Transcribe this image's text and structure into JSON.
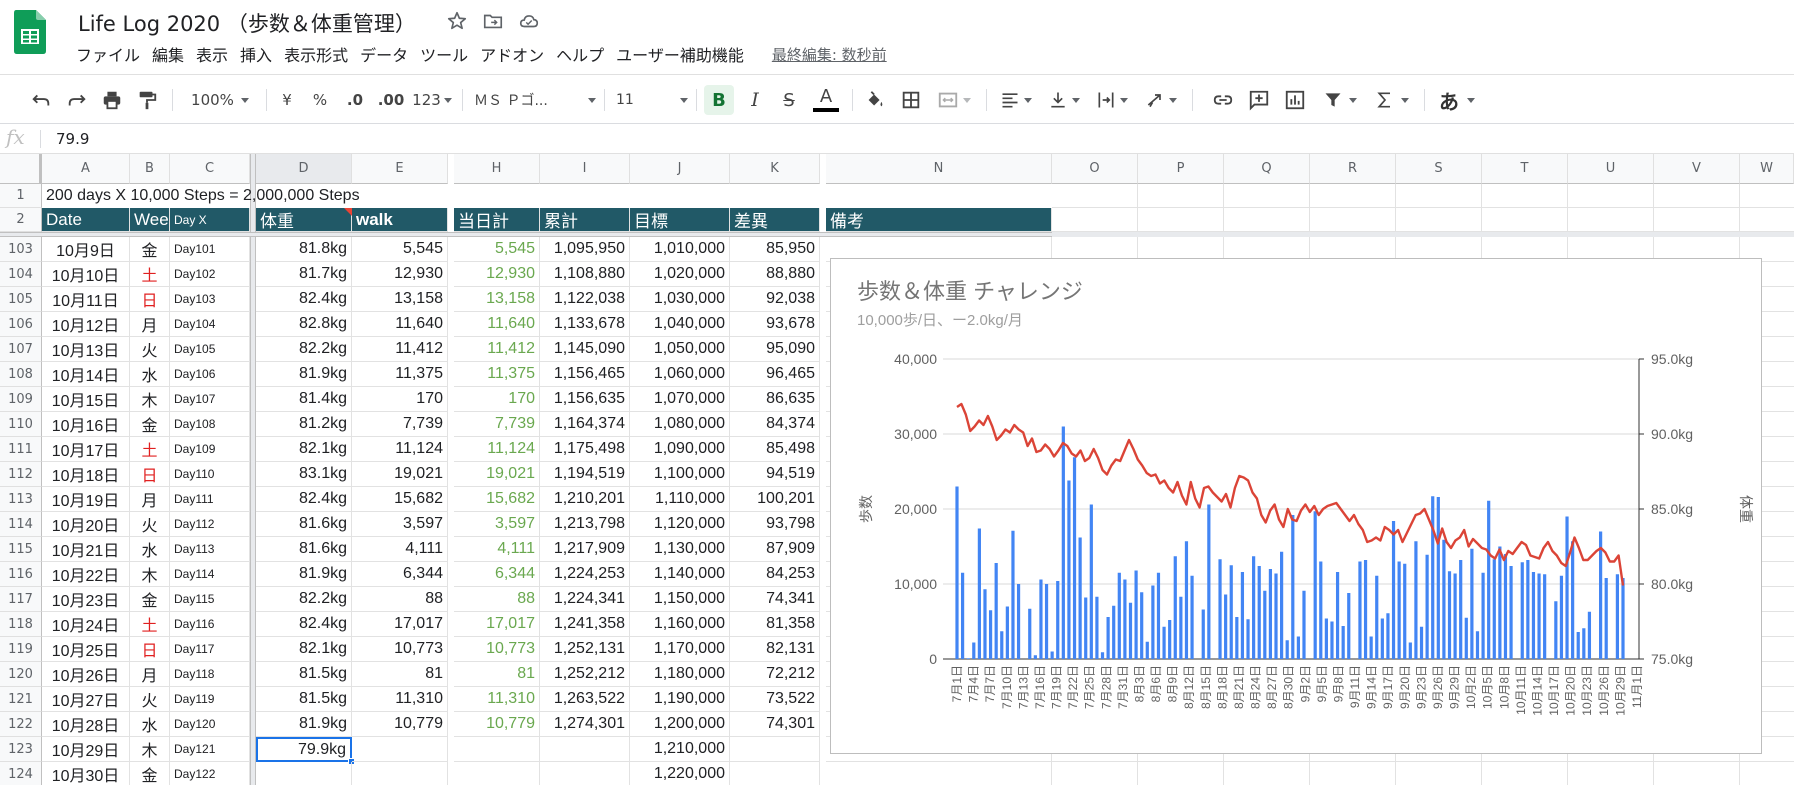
{
  "app": {
    "title": "Life Log 2020 （歩数＆体重管理）",
    "menu": [
      "ファイル",
      "編集",
      "表示",
      "挿入",
      "表示形式",
      "データ",
      "ツール",
      "アドオン",
      "ヘルプ",
      "ユーザー補助機能"
    ],
    "last_edit": "最終編集: 数秒前"
  },
  "toolbar": {
    "zoom": "100%",
    "currency": "¥",
    "percent": "%",
    "dec_less": ".0",
    "dec_more": ".00",
    "format_more": "123",
    "font": "ＭＳ Ｐゴ...",
    "font_size": "11",
    "bold": "B",
    "italic": "I",
    "strike": "S",
    "text_color": "A",
    "input_tool": "あ"
  },
  "formula_bar": {
    "fx": "fx",
    "value": "79.9"
  },
  "columns": {
    "A": "A",
    "B": "B",
    "C": "C",
    "D": "D",
    "E": "E",
    "H": "H",
    "I": "I",
    "J": "J",
    "K": "K",
    "N": "N",
    "O": "O",
    "P": "P",
    "Q": "Q",
    "R": "R",
    "S": "S",
    "T": "T",
    "U": "U",
    "V": "V",
    "W": "W"
  },
  "row1": {
    "num": "1",
    "text": "200 days X 10,000 Steps = 2,000,000 Steps"
  },
  "row2": {
    "num": "2",
    "date": "Date",
    "week": "Week",
    "dayx": "Day X",
    "weight": "体重",
    "walk": "walk",
    "today": "当日計",
    "cum": "累計",
    "target": "目標",
    "diff": "差異",
    "note": "備考"
  },
  "rows": [
    {
      "num": "103",
      "date": "10月9日",
      "week": "金",
      "wc": "",
      "day": "Day101",
      "wt": "81.8kg",
      "walk": "5,545",
      "today": "5,545",
      "cum": "1,095,950",
      "target": "1,010,000",
      "diff": "85,950"
    },
    {
      "num": "104",
      "date": "10月10日",
      "week": "土",
      "wc": "red",
      "day": "Day102",
      "wt": "81.7kg",
      "walk": "12,930",
      "today": "12,930",
      "cum": "1,108,880",
      "target": "1,020,000",
      "diff": "88,880"
    },
    {
      "num": "105",
      "date": "10月11日",
      "week": "日",
      "wc": "red",
      "day": "Day103",
      "wt": "82.4kg",
      "walk": "13,158",
      "today": "13,158",
      "cum": "1,122,038",
      "target": "1,030,000",
      "diff": "92,038"
    },
    {
      "num": "106",
      "date": "10月12日",
      "week": "月",
      "wc": "",
      "day": "Day104",
      "wt": "82.8kg",
      "walk": "11,640",
      "today": "11,640",
      "cum": "1,133,678",
      "target": "1,040,000",
      "diff": "93,678"
    },
    {
      "num": "107",
      "date": "10月13日",
      "week": "火",
      "wc": "",
      "day": "Day105",
      "wt": "82.2kg",
      "walk": "11,412",
      "today": "11,412",
      "cum": "1,145,090",
      "target": "1,050,000",
      "diff": "95,090"
    },
    {
      "num": "108",
      "date": "10月14日",
      "week": "水",
      "wc": "",
      "day": "Day106",
      "wt": "81.9kg",
      "walk": "11,375",
      "today": "11,375",
      "cum": "1,156,465",
      "target": "1,060,000",
      "diff": "96,465"
    },
    {
      "num": "109",
      "date": "10月15日",
      "week": "木",
      "wc": "",
      "day": "Day107",
      "wt": "81.4kg",
      "walk": "170",
      "today": "170",
      "cum": "1,156,635",
      "target": "1,070,000",
      "diff": "86,635"
    },
    {
      "num": "110",
      "date": "10月16日",
      "week": "金",
      "wc": "",
      "day": "Day108",
      "wt": "81.2kg",
      "walk": "7,739",
      "today": "7,739",
      "cum": "1,164,374",
      "target": "1,080,000",
      "diff": "84,374"
    },
    {
      "num": "111",
      "date": "10月17日",
      "week": "土",
      "wc": "red",
      "day": "Day109",
      "wt": "82.1kg",
      "walk": "11,124",
      "today": "11,124",
      "cum": "1,175,498",
      "target": "1,090,000",
      "diff": "85,498"
    },
    {
      "num": "112",
      "date": "10月18日",
      "week": "日",
      "wc": "red",
      "day": "Day110",
      "wt": "83.1kg",
      "walk": "19,021",
      "today": "19,021",
      "cum": "1,194,519",
      "target": "1,100,000",
      "diff": "94,519"
    },
    {
      "num": "113",
      "date": "10月19日",
      "week": "月",
      "wc": "",
      "day": "Day111",
      "wt": "82.4kg",
      "walk": "15,682",
      "today": "15,682",
      "cum": "1,210,201",
      "target": "1,110,000",
      "diff": "100,201"
    },
    {
      "num": "114",
      "date": "10月20日",
      "week": "火",
      "wc": "",
      "day": "Day112",
      "wt": "81.6kg",
      "walk": "3,597",
      "today": "3,597",
      "cum": "1,213,798",
      "target": "1,120,000",
      "diff": "93,798"
    },
    {
      "num": "115",
      "date": "10月21日",
      "week": "水",
      "wc": "",
      "day": "Day113",
      "wt": "81.6kg",
      "walk": "4,111",
      "today": "4,111",
      "cum": "1,217,909",
      "target": "1,130,000",
      "diff": "87,909"
    },
    {
      "num": "116",
      "date": "10月22日",
      "week": "木",
      "wc": "",
      "day": "Day114",
      "wt": "81.9kg",
      "walk": "6,344",
      "today": "6,344",
      "cum": "1,224,253",
      "target": "1,140,000",
      "diff": "84,253"
    },
    {
      "num": "117",
      "date": "10月23日",
      "week": "金",
      "wc": "",
      "day": "Day115",
      "wt": "82.2kg",
      "walk": "88",
      "today": "88",
      "cum": "1,224,341",
      "target": "1,150,000",
      "diff": "74,341"
    },
    {
      "num": "118",
      "date": "10月24日",
      "week": "土",
      "wc": "red",
      "day": "Day116",
      "wt": "82.4kg",
      "walk": "17,017",
      "today": "17,017",
      "cum": "1,241,358",
      "target": "1,160,000",
      "diff": "81,358"
    },
    {
      "num": "119",
      "date": "10月25日",
      "week": "日",
      "wc": "red",
      "day": "Day117",
      "wt": "82.1kg",
      "walk": "10,773",
      "today": "10,773",
      "cum": "1,252,131",
      "target": "1,170,000",
      "diff": "82,131"
    },
    {
      "num": "120",
      "date": "10月26日",
      "week": "月",
      "wc": "",
      "day": "Day118",
      "wt": "81.5kg",
      "walk": "81",
      "today": "81",
      "cum": "1,252,212",
      "target": "1,180,000",
      "diff": "72,212"
    },
    {
      "num": "121",
      "date": "10月27日",
      "week": "火",
      "wc": "",
      "day": "Day119",
      "wt": "81.5kg",
      "walk": "11,310",
      "today": "11,310",
      "cum": "1,263,522",
      "target": "1,190,000",
      "diff": "73,522"
    },
    {
      "num": "122",
      "date": "10月28日",
      "week": "水",
      "wc": "",
      "day": "Day120",
      "wt": "81.9kg",
      "walk": "10,779",
      "today": "10,779",
      "cum": "1,274,301",
      "target": "1,200,000",
      "diff": "74,301"
    },
    {
      "num": "123",
      "date": "10月29日",
      "week": "木",
      "wc": "",
      "day": "Day121",
      "wt": "79.9kg",
      "walk": "",
      "today": "",
      "cum": "",
      "target": "1,210,000",
      "diff": ""
    },
    {
      "num": "124",
      "date": "10月30日",
      "week": "金",
      "wc": "",
      "day": "Day122",
      "wt": "",
      "walk": "",
      "today": "",
      "cum": "",
      "target": "1,220,000",
      "diff": ""
    }
  ],
  "colors": {
    "header_bg": "#215967",
    "bar": "#4285f4",
    "line": "#db4437",
    "today_text": "#6aa84f",
    "weekend": "#e02020"
  },
  "chart_data": {
    "type": "bar",
    "title": "歩数＆体重 チャレンジ",
    "subtitle": "10,000歩/日、ー2.0kg/月",
    "ylabel_left": "歩数",
    "ylabel_right": "体重",
    "left_ticks": [
      "0",
      "10,000",
      "20,000",
      "30,000",
      "40,000"
    ],
    "right_ticks": [
      "75.0kg",
      "80.0kg",
      "85.0kg",
      "90.0kg",
      "95.0kg"
    ],
    "ylim_left": [
      0,
      40000
    ],
    "ylim_right": [
      75,
      95
    ],
    "x_tick_labels": [
      "7月1日",
      "7月4日",
      "7月7日",
      "7月10日",
      "7月13日",
      "7月16日",
      "7月19日",
      "7月22日",
      "7月25日",
      "7月28日",
      "7月31日",
      "8月3日",
      "8月6日",
      "8月9日",
      "8月12日",
      "8月15日",
      "8月18日",
      "8月21日",
      "8月24日",
      "8月27日",
      "8月30日",
      "9月2日",
      "9月5日",
      "9月8日",
      "9月11日",
      "9月14日",
      "9月17日",
      "9月20日",
      "9月23日",
      "9月26日",
      "9月29日",
      "10月2日",
      "10月5日",
      "10月8日",
      "10月11日",
      "10月14日",
      "10月17日",
      "10月20日",
      "10月23日",
      "10月26日",
      "10月29日",
      "11月1日"
    ],
    "grid": true,
    "series": [
      {
        "name": "歩数",
        "type": "bar",
        "values": [
          23000,
          11500,
          100,
          2200,
          17400,
          9300,
          6500,
          12800,
          3700,
          7000,
          17100,
          10000,
          0,
          6700,
          500,
          10600,
          10000,
          1000,
          10400,
          31000,
          23800,
          26900,
          16200,
          8200,
          20600,
          8300,
          900,
          5600,
          7100,
          11500,
          10600,
          7500,
          11800,
          8900,
          2300,
          9800,
          11500,
          4300,
          5200,
          13700,
          8300,
          15700,
          11100,
          0,
          6600,
          20600,
          0,
          13300,
          8600,
          12500,
          5600,
          11600,
          5300,
          13700,
          12400,
          9100,
          12000,
          11400,
          14300,
          2500,
          19200,
          3000,
          9100,
          0,
          19700,
          13000,
          5400,
          5000,
          11600,
          4400,
          8800,
          0,
          13000,
          13200,
          3000,
          11100,
          5400,
          6100,
          18400,
          13000,
          12700,
          2200,
          15700,
          4300,
          13900,
          21700,
          21600,
          15900,
          11700,
          11400,
          13200,
          5500,
          14700,
          3700,
          11500,
          21100,
          13300,
          15000,
          14000,
          12400,
          0,
          12900,
          13200,
          11600,
          11400,
          11300,
          0,
          7700,
          11100,
          19000,
          15700,
          3600,
          4100,
          6300,
          0,
          17000,
          10800,
          0,
          11300,
          10800
        ]
      },
      {
        "name": "体重",
        "type": "line",
        "values": [
          91.8,
          92.0,
          91.3,
          90.2,
          90.5,
          90.9,
          90.6,
          91.2,
          90.5,
          89.6,
          89.9,
          90.3,
          90.1,
          90.6,
          90.3,
          90.1,
          89.2,
          89.7,
          88.8,
          88.9,
          89.3,
          89.0,
          88.5,
          88.9,
          89.4,
          89.2,
          88.7,
          88.5,
          88.9,
          88.2,
          88.4,
          89.0,
          88.4,
          87.6,
          87.3,
          87.9,
          88.3,
          88.2,
          88.9,
          89.6,
          89.0,
          88.3,
          87.9,
          87.4,
          87.2,
          87.3,
          86.7,
          86.9,
          86.4,
          86.1,
          86.8,
          85.9,
          85.3,
          86.8,
          85.7,
          85.1,
          86.4,
          86.5,
          86.1,
          85.8,
          85.5,
          86.0,
          85.1,
          86.4,
          87.2,
          87.1,
          86.9,
          86.1,
          85.7,
          84.6,
          84.1,
          84.9,
          85.3,
          84.3,
          83.8,
          85.0,
          84.3,
          84.2,
          84.9,
          85.3,
          84.8,
          85.2,
          84.6,
          85.0,
          85.2,
          85.3,
          85.4,
          85.0,
          84.6,
          84.2,
          84.6,
          84.0,
          83.6,
          82.8,
          82.9,
          83.1,
          82.9,
          83.8,
          83.6,
          83.3,
          83.6,
          82.8,
          83.4,
          84.0,
          84.6,
          84.7,
          85.0,
          84.3,
          83.6,
          82.7,
          83.7,
          82.8,
          82.4,
          82.9,
          83.1,
          83.6,
          82.5,
          83.0,
          82.7,
          82.4,
          82.3,
          81.9,
          81.7,
          82.3,
          81.6,
          82.2,
          82.0,
          82.4,
          82.8,
          82.6,
          81.9,
          81.8,
          81.7,
          82.4,
          82.8,
          82.2,
          81.9,
          81.4,
          81.2,
          82.1,
          83.1,
          82.4,
          81.6,
          81.6,
          81.9,
          82.2,
          82.4,
          82.1,
          81.5,
          81.5,
          81.9,
          79.9
        ]
      }
    ]
  }
}
